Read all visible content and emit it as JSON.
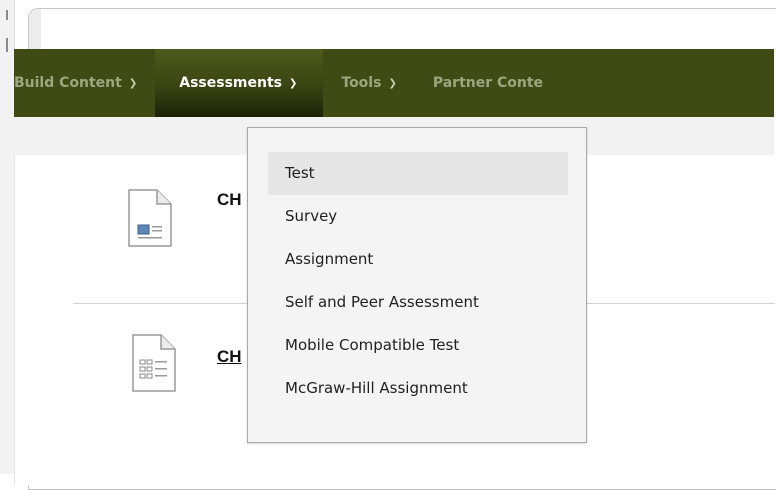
{
  "nav": {
    "items": [
      {
        "label": "Build Content"
      },
      {
        "label": "Assessments"
      },
      {
        "label": "Tools"
      },
      {
        "label": "Partner Conte"
      }
    ]
  },
  "content": {
    "items": [
      {
        "title": "CH"
      },
      {
        "title": "CH"
      }
    ]
  },
  "dropdown": {
    "items": [
      {
        "label": "Test"
      },
      {
        "label": "Survey"
      },
      {
        "label": "Assignment"
      },
      {
        "label": "Self and Peer Assessment"
      },
      {
        "label": "Mobile Compatible Test"
      },
      {
        "label": "McGraw-Hill Assignment"
      }
    ],
    "highlighted": "Test"
  },
  "colors": {
    "nav_bg": "#3f4a14",
    "nav_active": "#1c2107",
    "dropdown_bg": "#f4f4f4"
  },
  "icons": [
    "chevron-down-icon",
    "document-icon",
    "document-list-icon"
  ]
}
